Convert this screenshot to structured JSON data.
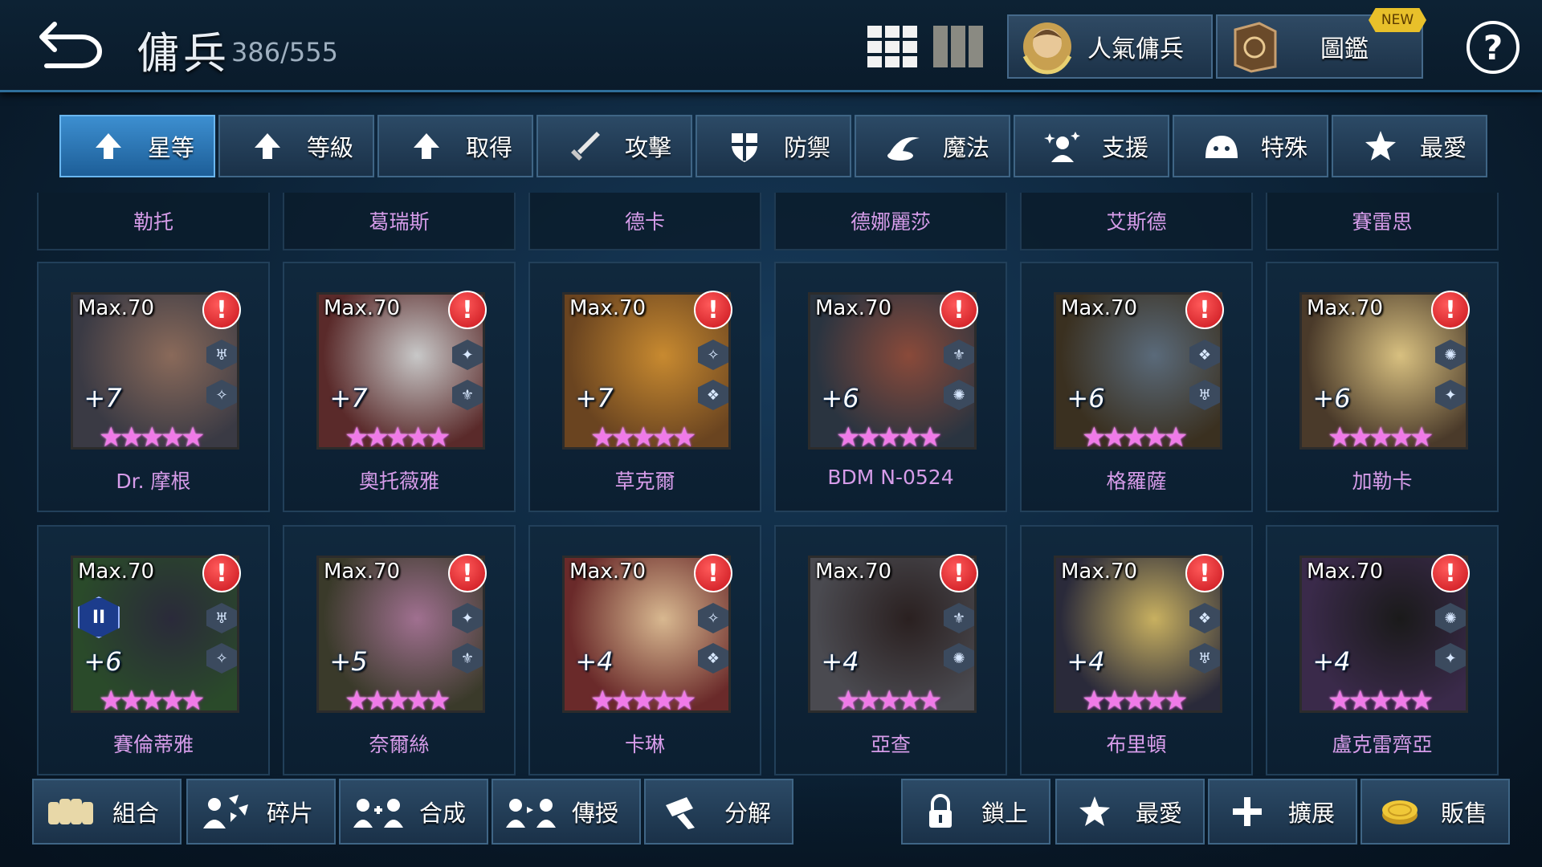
{
  "header": {
    "title": "傭兵",
    "count": "386/555",
    "popular_label": "人氣傭兵",
    "codex_label": "圖鑑",
    "new_badge": "NEW",
    "help": "?"
  },
  "sort_tabs": [
    {
      "label": "星等",
      "icon": "arrow-up-icon",
      "active": true
    },
    {
      "label": "等級",
      "icon": "arrow-up-icon"
    },
    {
      "label": "取得",
      "icon": "arrow-up-icon"
    },
    {
      "label": "攻擊",
      "icon": "sword-icon"
    },
    {
      "label": "防禦",
      "icon": "shield-icon"
    },
    {
      "label": "魔法",
      "icon": "magic-icon"
    },
    {
      "label": "支援",
      "icon": "support-icon"
    },
    {
      "label": "特殊",
      "icon": "special-icon"
    },
    {
      "label": "最愛",
      "icon": "star-icon"
    }
  ],
  "top_partial_names": [
    "勒托",
    "葛瑞斯",
    "德卡",
    "德娜麗莎",
    "艾斯德",
    "賽雷思"
  ],
  "cards": [
    {
      "name": "Dr. 摩根",
      "max": "Max.70",
      "plus": "+7",
      "stars": 5,
      "art": [
        "#3a3a44",
        "#8a6a5a"
      ]
    },
    {
      "name": "奧托薇雅",
      "max": "Max.70",
      "plus": "+7",
      "stars": 5,
      "art": [
        "#5a2a2a",
        "#c8c8c8"
      ]
    },
    {
      "name": "草克爾",
      "max": "Max.70",
      "plus": "+7",
      "stars": 5,
      "art": [
        "#6a4420",
        "#c88a30"
      ]
    },
    {
      "name": "BDM N-0524",
      "max": "Max.70",
      "plus": "+6",
      "stars": 5,
      "art": [
        "#2a3440",
        "#8a4a3a"
      ]
    },
    {
      "name": "格羅薩",
      "max": "Max.70",
      "plus": "+6",
      "stars": 5,
      "art": [
        "#3a3020",
        "#5a6a7a"
      ]
    },
    {
      "name": "加勒卡",
      "max": "Max.70",
      "plus": "+6",
      "stars": 5,
      "art": [
        "#4a3a2a",
        "#d8c080"
      ]
    },
    {
      "name": "賽倫蒂雅",
      "max": "Max.70",
      "plus": "+6",
      "stars": 5,
      "rank": "II",
      "art": [
        "#2a4a2a",
        "#2a2a3a"
      ]
    },
    {
      "name": "奈爾絲",
      "max": "Max.70",
      "plus": "+5",
      "stars": 5,
      "art": [
        "#3a3a2a",
        "#a07090"
      ]
    },
    {
      "name": "卡琳",
      "max": "Max.70",
      "plus": "+4",
      "stars": 5,
      "art": [
        "#6a2a2a",
        "#d8b890"
      ]
    },
    {
      "name": "亞查",
      "max": "Max.70",
      "plus": "+4",
      "stars": 5,
      "art": [
        "#4a4a50",
        "#2a2020"
      ]
    },
    {
      "name": "布里頓",
      "max": "Max.70",
      "plus": "+4",
      "stars": 5,
      "art": [
        "#2a2a3a",
        "#c8b060"
      ]
    },
    {
      "name": "盧克雷齊亞",
      "max": "Max.70",
      "plus": "+4",
      "stars": 5,
      "art": [
        "#3a2a4a",
        "#1a1a1a"
      ]
    }
  ],
  "bottom_buttons": [
    {
      "label": "組合",
      "icon": "party-icon"
    },
    {
      "label": "碎片",
      "icon": "fragments-icon"
    },
    {
      "label": "合成",
      "icon": "combine-icon"
    },
    {
      "label": "傳授",
      "icon": "transfer-icon"
    },
    {
      "label": "分解",
      "icon": "disassemble-icon"
    },
    {
      "label": "鎖上",
      "icon": "lock-icon"
    },
    {
      "label": "最愛",
      "icon": "star-icon"
    },
    {
      "label": "擴展",
      "icon": "plus-icon"
    },
    {
      "label": "販售",
      "icon": "gold-icon"
    }
  ]
}
